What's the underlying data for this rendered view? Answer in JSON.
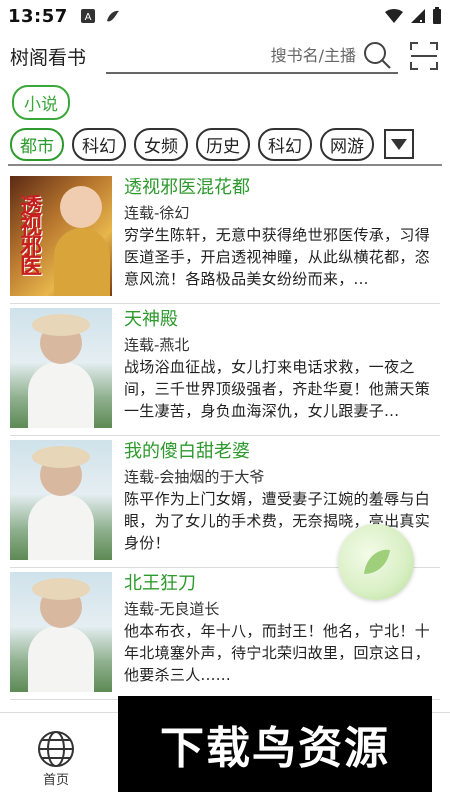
{
  "status": {
    "time": "13:57"
  },
  "header": {
    "app_title": "树阁看书",
    "search_placeholder": "搜书名/主播"
  },
  "category": {
    "label": "小说"
  },
  "tabs": [
    "都市",
    "科幻",
    "女频",
    "历史",
    "科幻",
    "网游"
  ],
  "books": [
    {
      "title": "透视邪医混花都",
      "meta": "连载-徐幻",
      "desc": "穷学生陈轩，无意中获得绝世邪医传承，习得医道圣手，开启透视神瞳，从此纵横花都，恣意风流！各路极品美女纷纷而来，...",
      "cover_text": "透视邪医"
    },
    {
      "title": "天神殿",
      "meta": "连载-燕北",
      "desc": "战场浴血征战，女儿打来电话求救，一夜之间，三千世界顶级强者，齐赴华夏！他萧天策一生凄苦，身负血海深仇，女儿跟妻子..."
    },
    {
      "title": "我的傻白甜老婆",
      "meta": "连载-会抽烟的于大爷",
      "desc": "陈平作为上门女婿，遭受妻子江婉的羞辱与白眼，为了女儿的手术费，无奈揭晓，亮出真实身份！"
    },
    {
      "title": "北王狂刀",
      "meta": "连载-无良道长",
      "desc": "他本布衣，年十八，而封王！他名，宁北！十年北境塞外声，待宁北荣归故里，回京这日，他要杀三人......"
    }
  ],
  "nav": {
    "home_label": "首页"
  },
  "watermark": "下载鸟资源"
}
